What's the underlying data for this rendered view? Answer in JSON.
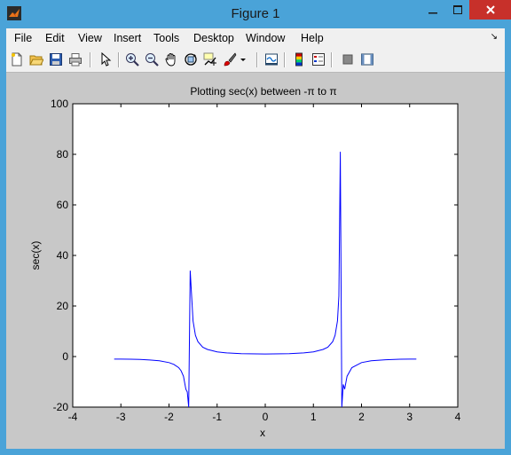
{
  "window": {
    "title": "Figure 1"
  },
  "menu": [
    "File",
    "Edit",
    "View",
    "Insert",
    "Tools",
    "Desktop",
    "Window",
    "Help"
  ],
  "toolbar": {
    "icons": [
      "new-figure-icon",
      "open-file-icon",
      "save-icon",
      "print-icon",
      "select-arrow-icon",
      "zoom-in-icon",
      "zoom-out-icon",
      "pan-hand-icon",
      "rotate-3d-icon",
      "data-cursor-icon",
      "brush-icon",
      "brush-dropdown-icon",
      "link-plot-icon",
      "colorbar-icon",
      "legend-icon",
      "hide-plot-tools-icon",
      "show-plot-tools-icon"
    ]
  },
  "colors": {
    "line": "#0000ff",
    "axes_bg": "#ffffff",
    "figure_bg": "#c8c8c8"
  },
  "chart_data": {
    "type": "line",
    "title": "Plotting sec(x) between -π to π",
    "xlabel": "x",
    "ylabel": "sec(x)",
    "xlim": [
      -4,
      4
    ],
    "ylim": [
      -20,
      100
    ],
    "xticks": [
      "-4",
      "-3",
      "-2",
      "-1",
      "0",
      "1",
      "2",
      "3",
      "4"
    ],
    "yticks": [
      "-20",
      "0",
      "20",
      "40",
      "60",
      "80",
      "100"
    ],
    "grid": false,
    "series": [
      {
        "x": [
          -3.14,
          -3.0,
          -2.8,
          -2.6,
          -2.4,
          -2.2,
          -2.0,
          -1.9,
          -1.8,
          -1.75,
          -1.7,
          -1.65,
          -1.62,
          -1.59,
          -1.56,
          -1.53,
          -1.5,
          -1.45,
          -1.4,
          -1.3,
          -1.2,
          -1.0,
          -0.8,
          -0.5,
          0,
          0.5,
          0.8,
          1.0,
          1.2,
          1.3,
          1.4,
          1.45,
          1.5,
          1.53,
          1.56,
          1.59,
          1.62,
          1.65,
          1.7,
          1.8,
          2.0,
          2.2,
          2.5,
          2.8,
          3.0,
          3.14
        ],
        "y": [
          -1,
          -1.01,
          -1.06,
          -1.17,
          -1.36,
          -1.7,
          -2.4,
          -3.1,
          -4.4,
          -5.6,
          -7.8,
          -12.9,
          -14,
          -20,
          34,
          24,
          14.1,
          8.4,
          5.9,
          3.7,
          2.8,
          1.85,
          1.44,
          1.14,
          1,
          1.14,
          1.44,
          1.85,
          2.8,
          3.7,
          5.9,
          8.4,
          14.1,
          24,
          81,
          -20,
          -11,
          -12.9,
          -7.8,
          -4.4,
          -2.4,
          -1.7,
          -1.25,
          -1.06,
          -1.01,
          -1
        ]
      }
    ]
  }
}
